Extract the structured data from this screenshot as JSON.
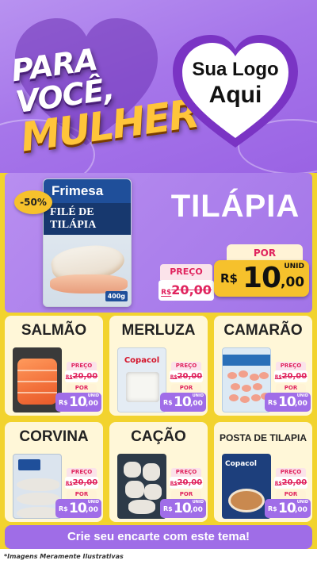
{
  "header": {
    "title_line1": "PARA VOCÊ,",
    "title_line2": "MULHER",
    "logo_line1": "Sua Logo",
    "logo_line2": "Aqui"
  },
  "featured": {
    "discount": "-50%",
    "brand": "Frimesa",
    "product_label": "FILÉ DE TILÁPIA",
    "weight": "400g",
    "name": "TILÁPIA",
    "preco_label": "PREÇO",
    "old_currency": "R$",
    "old_price": "20,00",
    "por_label": "POR",
    "new_currency": "R$",
    "new_int": "10",
    "new_dec": ",00",
    "unit": "UNID"
  },
  "products": [
    {
      "name": "SALMÃO",
      "preco_label": "PREÇO",
      "old_currency": "R$",
      "old_price": "20,00",
      "por_label": "POR",
      "new_currency": "R$",
      "new_int": "10",
      "new_dec": ",00",
      "unit": "UNID"
    },
    {
      "name": "MERLUZA",
      "brand": "Copacol",
      "preco_label": "PREÇO",
      "old_currency": "R$",
      "old_price": "20,00",
      "por_label": "POR",
      "new_currency": "R$",
      "new_int": "10",
      "new_dec": ",00",
      "unit": "UNID"
    },
    {
      "name": "CAMARÃO",
      "preco_label": "PREÇO",
      "old_currency": "R$",
      "old_price": "20,00",
      "por_label": "POR",
      "new_currency": "R$",
      "new_int": "10",
      "new_dec": ",00",
      "unit": "UNID"
    },
    {
      "name": "CORVINA",
      "preco_label": "PREÇO",
      "old_currency": "R$",
      "old_price": "20,00",
      "por_label": "POR",
      "new_currency": "R$",
      "new_int": "10",
      "new_dec": ",00",
      "unit": "UNID"
    },
    {
      "name": "CAÇÃO",
      "preco_label": "PREÇO",
      "old_currency": "R$",
      "old_price": "20,00",
      "por_label": "POR",
      "new_currency": "R$",
      "new_int": "10",
      "new_dec": ",00",
      "unit": "UNID"
    },
    {
      "name": "POSTA DE TILAPIA",
      "brand": "Copacol",
      "preco_label": "PREÇO",
      "old_currency": "R$",
      "old_price": "20,00",
      "por_label": "POR",
      "new_currency": "R$",
      "new_int": "10",
      "new_dec": ",00",
      "unit": "UNID"
    }
  ],
  "cta": "Crie seu encarte com este tema!",
  "disclaimer": "*Imagens Meramente Ilustrativas",
  "colors": {
    "purple": "#a274e8",
    "yellow": "#f2d32e",
    "pink": "#e0245e",
    "gold": "#f6c12c"
  }
}
